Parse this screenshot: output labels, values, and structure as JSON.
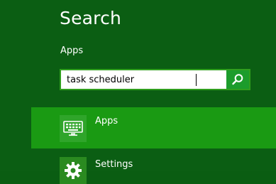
{
  "charm": {
    "title": "Search",
    "scope_label": "Apps"
  },
  "search": {
    "value": "task scheduler",
    "clear_icon": "close-icon",
    "submit_icon": "search-icon"
  },
  "results": [
    {
      "label": "Apps",
      "icon": "keyboard-icon",
      "selected": true
    },
    {
      "label": "Settings",
      "icon": "gear-icon",
      "selected": false
    }
  ],
  "colors": {
    "background": "#0b5e13",
    "selected_row": "#1a9a13",
    "accent": "#1c9c2c",
    "tile": "#2fa52a"
  }
}
